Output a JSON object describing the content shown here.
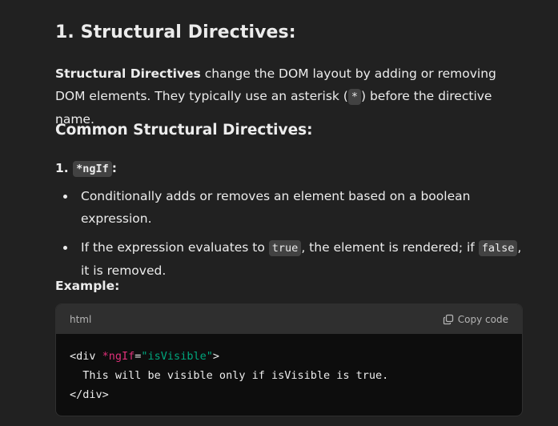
{
  "section": {
    "title": "1. Structural Directives:"
  },
  "intro": {
    "bold": "Structural Directives",
    "text_1": " change the DOM layout by adding or removing DOM elements. They typically use an asterisk (",
    "code": "*",
    "text_2": ") before the directive name."
  },
  "subsection": {
    "title": "Common Structural Directives:"
  },
  "item": {
    "number": "1.",
    "code": "*ngIf",
    "suffix": ":"
  },
  "bullets": {
    "b1": "Conditionally adds or removes an element based on a boolean expression.",
    "b2_part1": "If the expression evaluates to ",
    "b2_code1": "true",
    "b2_part2": ", the element is rendered; if ",
    "b2_code2": "false",
    "b2_part3": ", it is removed."
  },
  "example": {
    "label": "Example:"
  },
  "code_block": {
    "language": "html",
    "copy_label": "Copy code",
    "copy_icon": "copy-icon",
    "line1_open": "<div ",
    "line1_attr": "*ngIf",
    "line1_eq": "=",
    "line1_str": "\"isVisible\"",
    "line1_close": ">",
    "line2": "  This will be visible only if isVisible is true.",
    "line3": "</div>"
  },
  "colors": {
    "background": "#212121",
    "text": "#ececec",
    "code_header_bg": "#2f2f2f",
    "code_body_bg": "#0d0d0d",
    "inline_code_bg": "#424242",
    "attr_color": "#df3079",
    "string_color": "#00a67d"
  }
}
